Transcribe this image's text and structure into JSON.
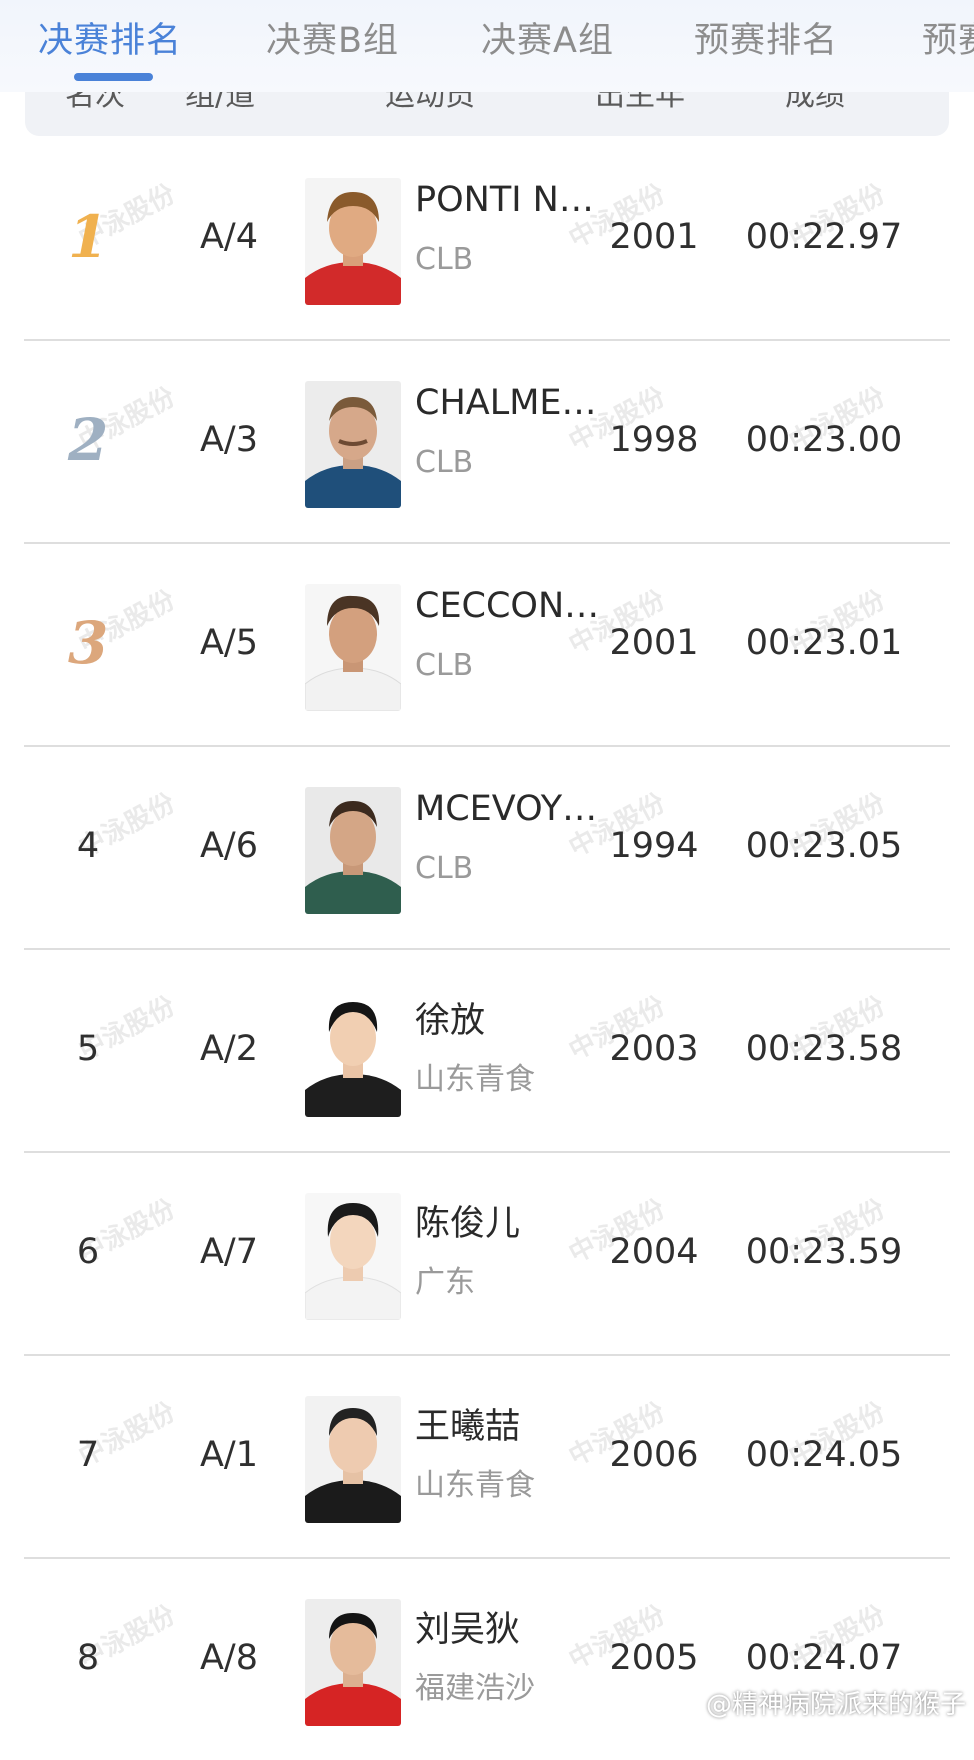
{
  "tabs": [
    {
      "label": "决赛排名",
      "active": true
    },
    {
      "label": "决赛B组",
      "active": false
    },
    {
      "label": "决赛A组",
      "active": false
    },
    {
      "label": "预赛排名",
      "active": false
    },
    {
      "label": "预赛",
      "active": false
    }
  ],
  "header": {
    "rank": "名次",
    "lane": "组/道",
    "athlete": "运动员",
    "year": "出生年",
    "result": "成绩"
  },
  "watermark": "中泳股份",
  "credit": "@精神病院派来的猴子",
  "colors": {
    "accent": "#4a82d8",
    "gold": "#f0b14f",
    "silver": "#9fb0c2",
    "bronze": "#dca77c"
  },
  "rows": [
    {
      "rank": "1",
      "medal": "gold",
      "lane": "A/4",
      "name": "PONTI NOE",
      "team": "CLB",
      "year": "2001",
      "time": "00:22.97"
    },
    {
      "rank": "2",
      "medal": "silver",
      "lane": "A/3",
      "name": "CHALMERS KYLE",
      "team": "CLB",
      "year": "1998",
      "time": "00:23.00"
    },
    {
      "rank": "3",
      "medal": "bronze",
      "lane": "A/5",
      "name": "CECCON THOMAS",
      "team": "CLB",
      "year": "2001",
      "time": "00:23.01"
    },
    {
      "rank": "4",
      "medal": "",
      "lane": "A/6",
      "name": "MCEVOY CAMERON",
      "team": "CLB",
      "year": "1994",
      "time": "00:23.05"
    },
    {
      "rank": "5",
      "medal": "",
      "lane": "A/2",
      "name": "徐放",
      "team": "山东青食",
      "year": "2003",
      "time": "00:23.58"
    },
    {
      "rank": "6",
      "medal": "",
      "lane": "A/7",
      "name": "陈俊儿",
      "team": "广东",
      "year": "2004",
      "time": "00:23.59"
    },
    {
      "rank": "7",
      "medal": "",
      "lane": "A/1",
      "name": "王曦喆",
      "team": "山东青食",
      "year": "2006",
      "time": "00:24.05"
    },
    {
      "rank": "8",
      "medal": "",
      "lane": "A/8",
      "name": "刘吴狄",
      "team": "福建浩沙",
      "year": "2005",
      "time": "00:24.07"
    }
  ]
}
